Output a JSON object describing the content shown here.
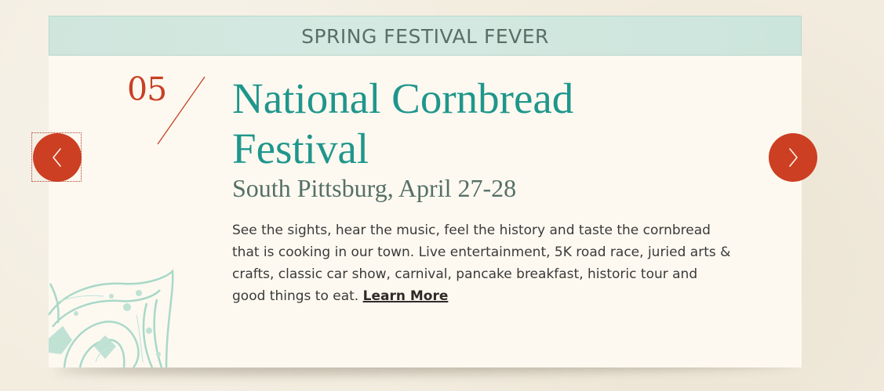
{
  "banner": {
    "title": "SPRING FESTIVAL FEVER"
  },
  "festival": {
    "number": "05",
    "title": "National Cornbread Festival",
    "location_date": "South Pittsburg, April 27-28",
    "description": "See the sights, hear the music, feel the history and taste the cornbread that is cooking in our town. Live entertainment, 5K road race, juried arts & crafts, classic car show, carnival, pancake breakfast, historic tour and good things to eat.",
    "learn_more_label": "Learn More"
  },
  "navigation": {
    "prev_icon": "chevron-left-icon",
    "next_icon": "chevron-right-icon"
  },
  "colors": {
    "accent_red": "#cc3f22",
    "title_teal": "#1f968c",
    "banner_mint": "#cfe6dd",
    "card_background": "#fdf9f0",
    "page_background": "#f3ede0"
  }
}
